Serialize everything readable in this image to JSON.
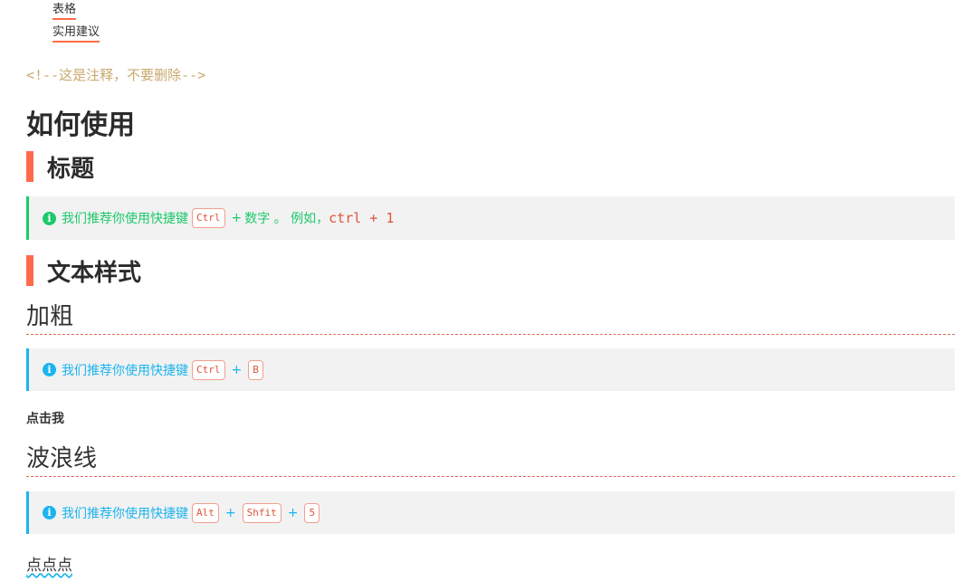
{
  "toc": {
    "items": [
      "表格",
      "实用建议"
    ]
  },
  "comment": "<!--这是注释，不要删除-->",
  "title": "如何使用",
  "sections": {
    "heading": {
      "title": "标题",
      "tip": {
        "prefix": "我们推荐你使用快捷键",
        "key1": "Ctrl",
        "plus1": "+",
        "text2": "数字 。 例如，",
        "example": "ctrl + 1"
      }
    },
    "text_style": {
      "title": "文本样式",
      "bold": {
        "title": "加粗",
        "tip": {
          "prefix": "我们推荐你使用快捷键",
          "key1": "Ctrl",
          "plus1": "+",
          "key2": "B"
        },
        "demo": "点击我"
      },
      "wavy": {
        "title": "波浪线",
        "tip": {
          "prefix": "我们推荐你使用快捷键",
          "key1": "Alt",
          "plus1": "+",
          "key2": "Shfit",
          "plus2": "+",
          "key3": "5"
        },
        "demo": "点点点"
      }
    }
  },
  "colors": {
    "accent": "#ff6b4a",
    "green": "#1cc96b",
    "blue": "#1bb4ef",
    "comment": "#c9a96e"
  }
}
